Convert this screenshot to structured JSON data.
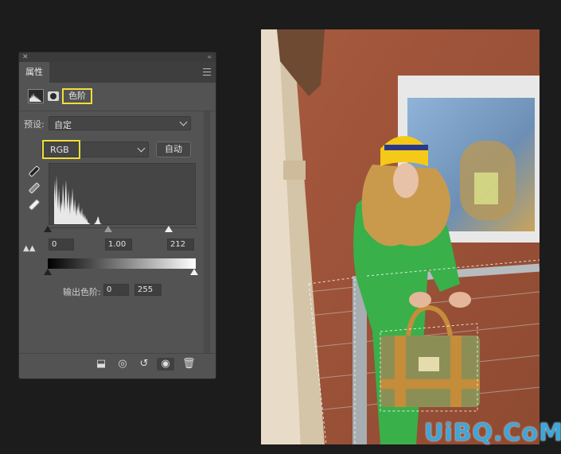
{
  "panel": {
    "tab_label": "属性",
    "adjustment_title": "色阶",
    "preset_label": "预设:",
    "preset_value": "自定",
    "channel_value": "RGB",
    "auto_label": "自动",
    "input_black": "0",
    "input_gamma": "1.00",
    "input_white": "212",
    "output_label": "输出色阶:",
    "output_black": "0",
    "output_white": "255"
  },
  "colors": {
    "highlight": "#f2de3a",
    "panel_bg": "#535353",
    "wall": "#9c5439",
    "dress_green": "#39b04a",
    "hat_yellow": "#f5c918",
    "watermark": "#3ea6d9"
  },
  "icons": {
    "footer": [
      "clip-to-layer-icon",
      "view-previous-icon",
      "reset-icon",
      "visibility-eye-icon",
      "trash-icon"
    ]
  },
  "watermark": "UiBQ.CoM"
}
